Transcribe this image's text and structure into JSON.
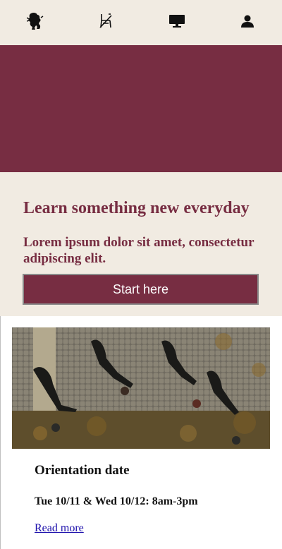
{
  "nav": {
    "items": [
      {
        "icon": "lion-logo-icon"
      },
      {
        "icon": "crossed-chair-icon"
      },
      {
        "icon": "monitor-icon"
      },
      {
        "icon": "user-icon"
      }
    ]
  },
  "hero": {
    "banner_color": "#772d42"
  },
  "intro": {
    "title": "Learn something new everyday",
    "subtitle": "Lorem ipsum dolor sit amet, consectetur adipiscing elit.",
    "cta_label": "Start here"
  },
  "card": {
    "title": "Orientation date",
    "date": "Tue 10/11 & Wed 10/12: 8am-3pm",
    "link_label": "Read more"
  },
  "colors": {
    "brand": "#772d42",
    "background": "#f1ebe2",
    "link": "#1a0dab"
  }
}
